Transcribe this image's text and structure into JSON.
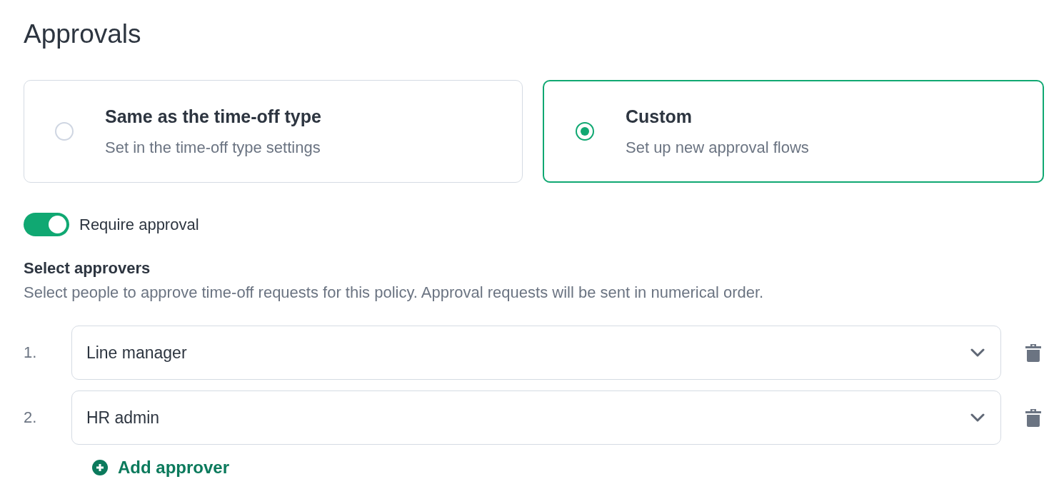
{
  "title": "Approvals",
  "options": [
    {
      "title": "Same as the time-off type",
      "subtitle": "Set in the time-off type settings",
      "selected": false
    },
    {
      "title": "Custom",
      "subtitle": "Set up new approval flows",
      "selected": true
    }
  ],
  "require_approval": {
    "label": "Require approval",
    "on": true
  },
  "approvers_section": {
    "heading": "Select approvers",
    "description": "Select people to approve time-off requests for this policy. Approval requests will be sent in numerical order."
  },
  "approvers": [
    {
      "number": "1.",
      "value": "Line manager"
    },
    {
      "number": "2.",
      "value": "HR admin"
    }
  ],
  "add_button": {
    "label": "Add approver"
  }
}
